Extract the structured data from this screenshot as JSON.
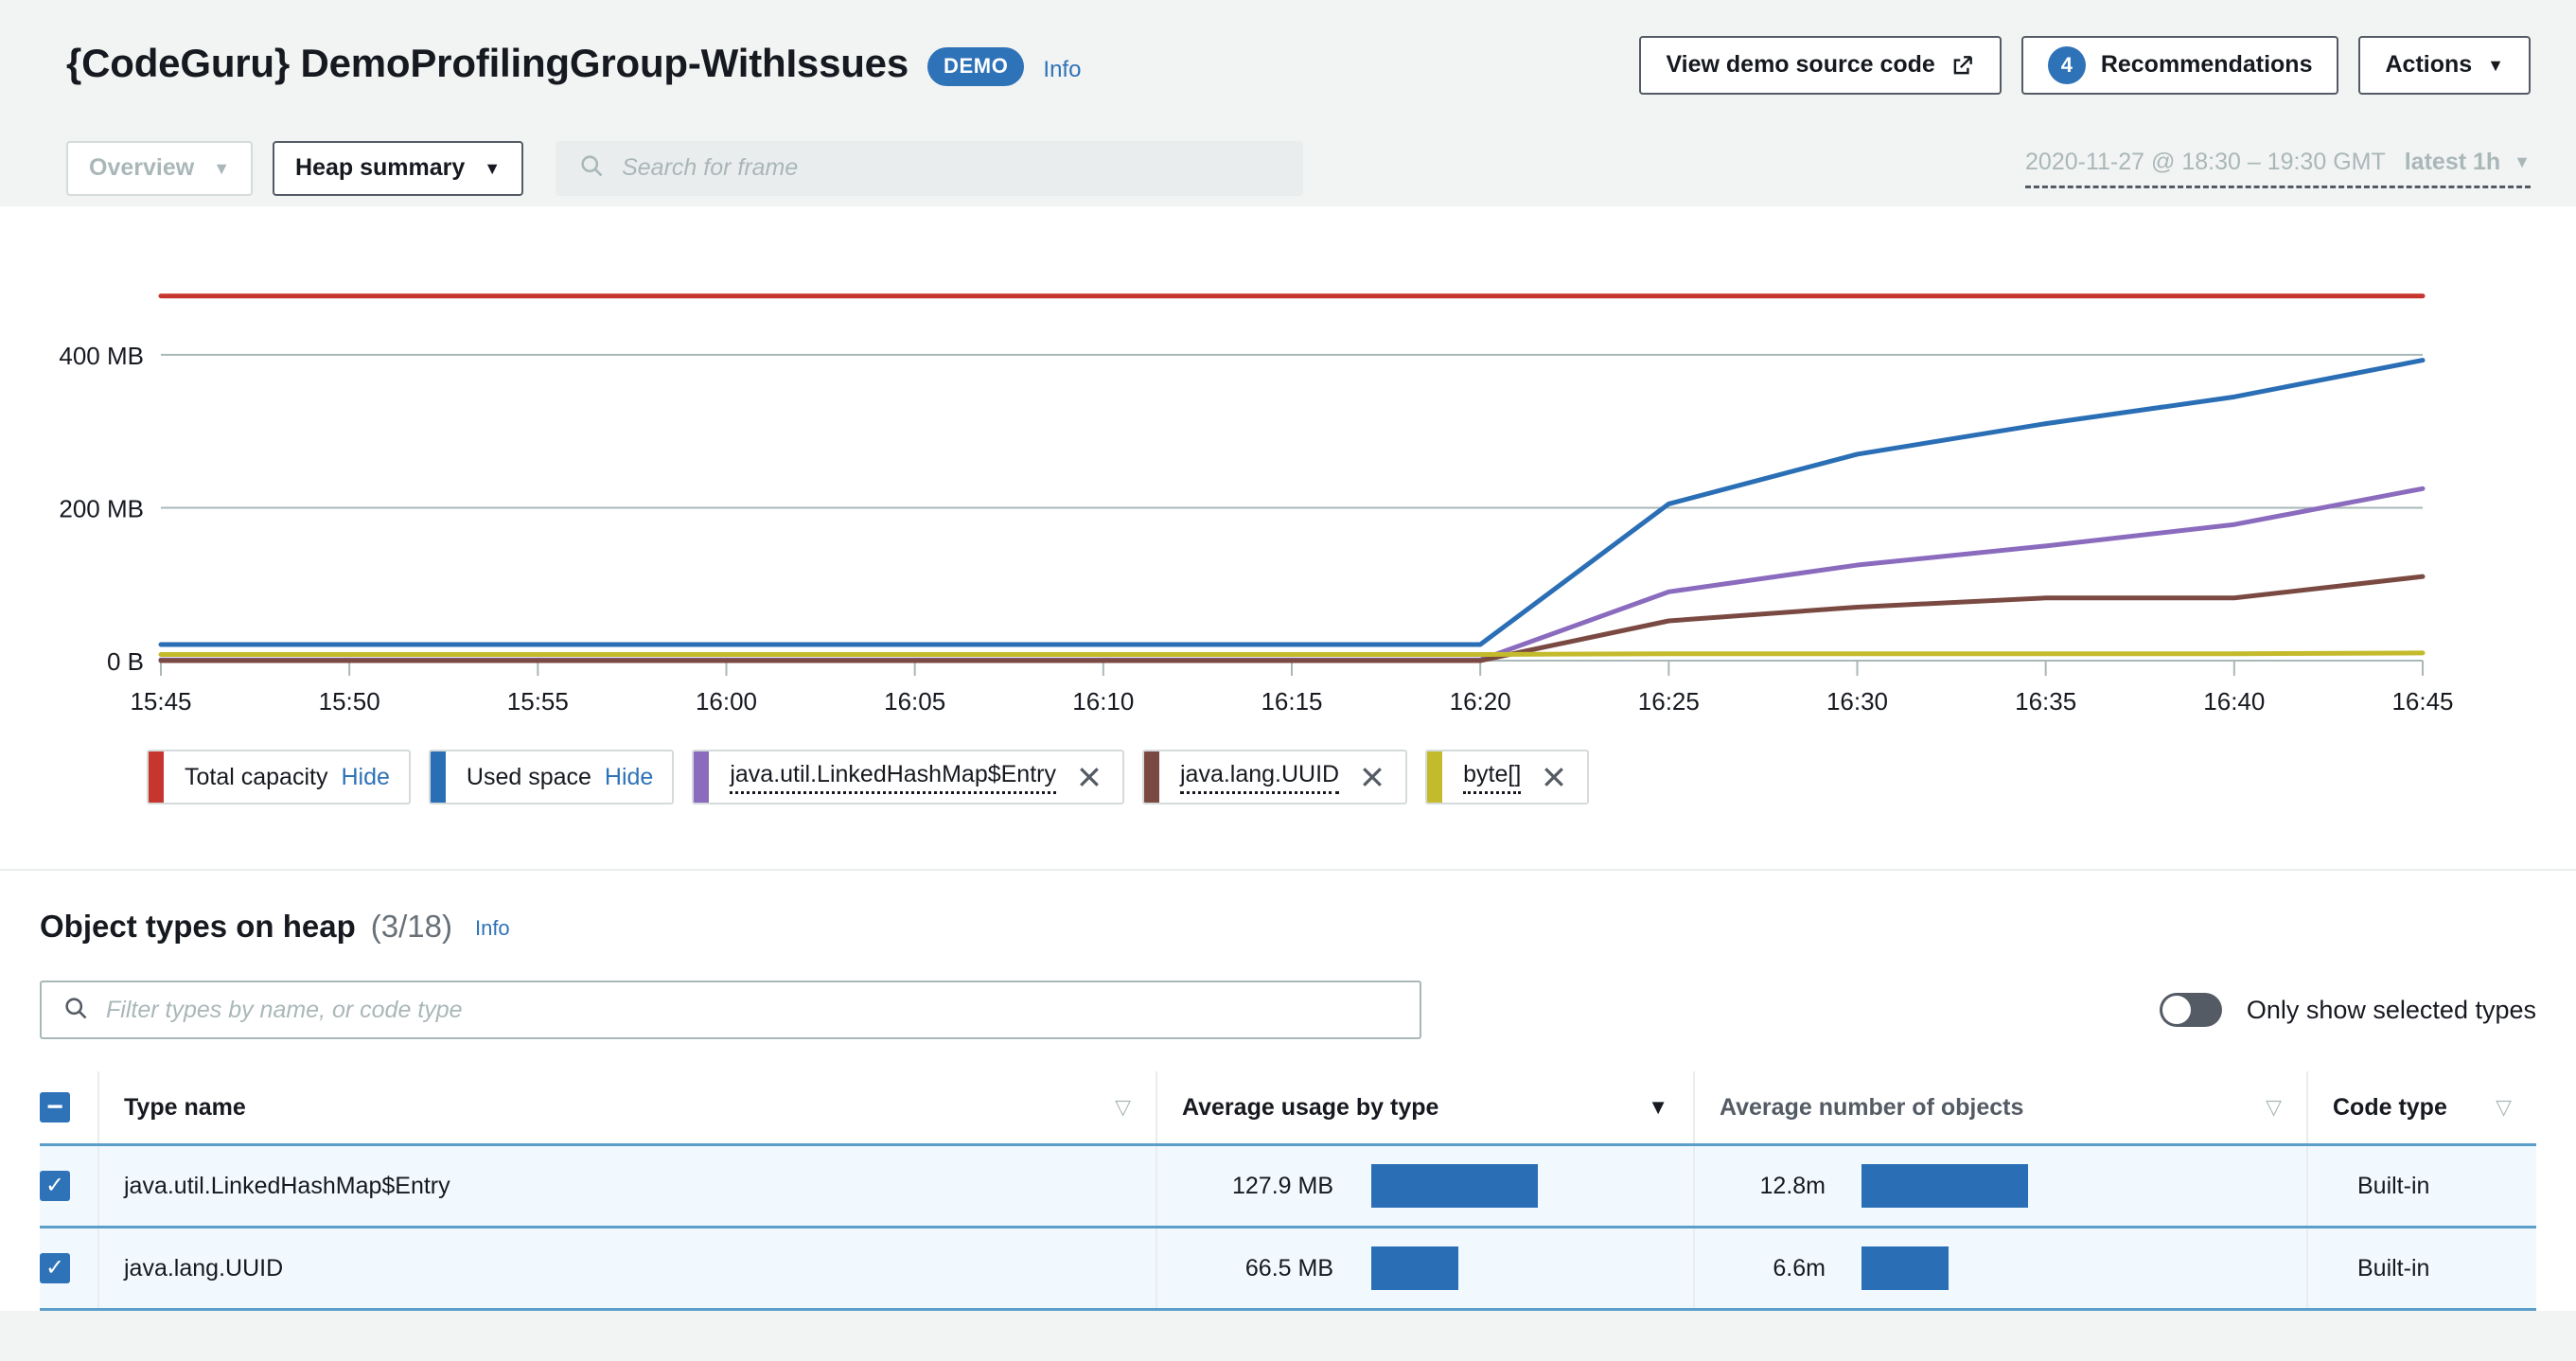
{
  "header": {
    "title": "{CodeGuru} DemoProfilingGroup-WithIssues",
    "badge": "DEMO",
    "info_label": "Info",
    "view_source_label": "View demo source code",
    "recommendations_count": "4",
    "recommendations_label": "Recommendations",
    "actions_label": "Actions",
    "caret": "▼"
  },
  "toolbar": {
    "overview_label": "Overview",
    "heap_summary_label": "Heap summary",
    "search_placeholder": "Search for frame",
    "date_range": "2020-11-27 @ 18:30 – 19:30 GMT",
    "date_selector": "latest 1h",
    "caret": "▼"
  },
  "chart_data": {
    "type": "line",
    "title": "",
    "xlabel": "",
    "ylabel": "",
    "x": [
      "15:45",
      "15:50",
      "15:55",
      "16:00",
      "16:05",
      "16:10",
      "16:15",
      "16:20",
      "16:25",
      "16:30",
      "16:35",
      "16:40",
      "16:45"
    ],
    "ytick_labels": [
      "0 B",
      "200 MB",
      "400 MB"
    ],
    "ytick_values": [
      0,
      200,
      400
    ],
    "ylim": [
      0,
      520
    ],
    "grid": true,
    "legend_position": "bottom",
    "series": [
      {
        "name": "Total capacity",
        "color": "#c6362f",
        "action": "Hide",
        "removable": false,
        "values": [
          477,
          477,
          477,
          477,
          477,
          477,
          477,
          477,
          477,
          477,
          477,
          477,
          477
        ]
      },
      {
        "name": "Used space",
        "color": "#2a6eb5",
        "action": "Hide",
        "removable": false,
        "values": [
          21,
          21,
          21,
          21,
          21,
          21,
          21,
          21,
          205,
          270,
          310,
          345,
          393
        ]
      },
      {
        "name": "java.util.LinkedHashMap$Entry",
        "color": "#8a6bbe",
        "action": "",
        "removable": true,
        "values": [
          1,
          1,
          1,
          1,
          1,
          1,
          1,
          1,
          90,
          125,
          150,
          178,
          225
        ]
      },
      {
        "name": "java.lang.UUID",
        "color": "#7a4a42",
        "action": "",
        "removable": true,
        "values": [
          0,
          0,
          0,
          0,
          0,
          0,
          0,
          0,
          52,
          70,
          82,
          82,
          110
        ]
      },
      {
        "name": "byte[]",
        "color": "#c3bb2c",
        "action": "",
        "removable": true,
        "values": [
          8,
          8,
          8,
          8,
          8,
          8,
          8,
          8,
          9,
          9,
          9,
          9,
          10
        ]
      }
    ]
  },
  "object_types": {
    "title": "Object types on heap",
    "count": "(3/18)",
    "info_label": "Info",
    "filter_placeholder": "Filter types by name, or code type",
    "toggle_label": "Only show selected types",
    "toggle_on": false,
    "columns": [
      {
        "label": "Type name",
        "sorted": false
      },
      {
        "label": "Average usage by type",
        "sorted": true
      },
      {
        "label": "Average number of objects",
        "sorted": false
      },
      {
        "label": "Code type",
        "sorted": false
      }
    ],
    "sort_active_glyph": "▼",
    "sort_idle_glyph": "▽",
    "select_all_state": "indeterminate",
    "rows": [
      {
        "selected": true,
        "type_name": "java.util.LinkedHashMap$Entry",
        "avg_usage": "127.9 MB",
        "usage_bar_pct": 100,
        "avg_objects": "12.8m",
        "objects_bar_pct": 100,
        "code_type": "Built-in"
      },
      {
        "selected": true,
        "type_name": "java.lang.UUID",
        "avg_usage": "66.5 MB",
        "usage_bar_pct": 52,
        "avg_objects": "6.6m",
        "objects_bar_pct": 52,
        "code_type": "Built-in"
      }
    ]
  },
  "colors": {
    "accent": "#2e72b8",
    "bar": "#2a6eb5",
    "row_selected": "#f1f8fe"
  }
}
